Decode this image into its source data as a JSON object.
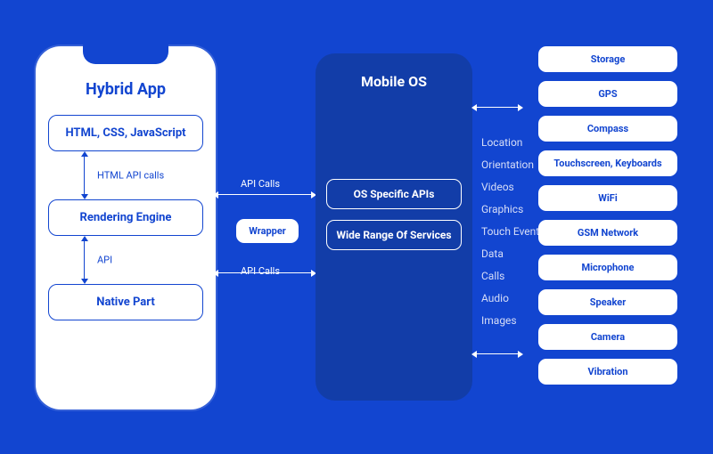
{
  "hybrid": {
    "title": "Hybrid App",
    "blocks": {
      "web": "HTML, CSS, JavaScript",
      "engine": "Rendering Engine",
      "native": "Native Part"
    },
    "conn1_label": "HTML API calls",
    "conn2_label": "API"
  },
  "bridge": {
    "api_calls": "API Calls",
    "wrapper": "Wrapper"
  },
  "mobile_os": {
    "title": "Mobile OS",
    "os_apis": "OS Specific APIs",
    "services": "Wide Range Of Services"
  },
  "features": [
    "Location",
    "Orientation",
    "Videos",
    "Graphics",
    "Touch Events",
    "Data",
    "Calls",
    "Audio",
    "Images"
  ],
  "hardware": [
    "Storage",
    "GPS",
    "Compass",
    "Touchscreen, Keyboards",
    "WiFi",
    "GSM Network",
    "Microphone",
    "Speaker",
    "Camera",
    "Vibration"
  ]
}
